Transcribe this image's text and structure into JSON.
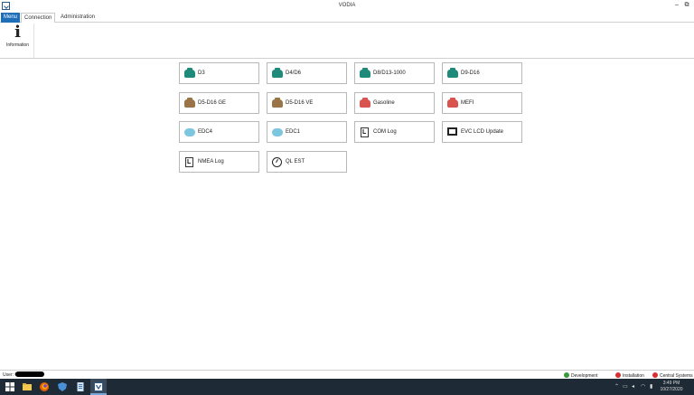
{
  "window": {
    "title": "VODIA",
    "minimize": "–",
    "maximize": "⧉"
  },
  "menubar": {
    "tabs": [
      {
        "label": "Menu"
      },
      {
        "label": "Connection"
      },
      {
        "label": "Administration"
      }
    ]
  },
  "ribbon": {
    "info_glyph": "i",
    "info_label": "Information"
  },
  "tiles": [
    {
      "label": "D3",
      "icon": "engine-icon",
      "color": "#1e8a7a"
    },
    {
      "label": "D4/D6",
      "icon": "engine-icon",
      "color": "#1e8a7a"
    },
    {
      "label": "D8/D13-1000",
      "icon": "engine-icon",
      "color": "#1e8a7a"
    },
    {
      "label": "D9-D16",
      "icon": "engine-icon",
      "color": "#1e8a7a"
    },
    {
      "label": "D5-D16 GE",
      "icon": "engine-icon",
      "color": "#9a7446"
    },
    {
      "label": "D5-D16 VE",
      "icon": "engine-icon",
      "color": "#9a7446"
    },
    {
      "label": "Gasoline",
      "icon": "engine-icon",
      "color": "#d9534f"
    },
    {
      "label": "MEFI",
      "icon": "engine-icon",
      "color": "#d9534f"
    },
    {
      "label": "EDC4",
      "icon": "cloud-icon",
      "color": "#7cc6df"
    },
    {
      "label": "EDC1",
      "icon": "cloud-icon",
      "color": "#7cc6df"
    },
    {
      "label": "COM Log",
      "icon": "log-icon",
      "color": "#333333"
    },
    {
      "label": "EVC LCD Update",
      "icon": "monitor-icon",
      "color": "#222222"
    },
    {
      "label": "NMEA Log",
      "icon": "log-icon",
      "color": "#333333"
    },
    {
      "label": "QL EST",
      "icon": "gauge-icon",
      "color": "#222222"
    }
  ],
  "status": {
    "user_label": "User: O",
    "development": "Development",
    "installation": "Installation",
    "central": "Central Systems",
    "development_color": "#3a9a3a",
    "installation_color": "#d63030",
    "central_color": "#d63030"
  },
  "taskbar": {
    "time": "3:49 PM",
    "date": "10/27/2020"
  }
}
